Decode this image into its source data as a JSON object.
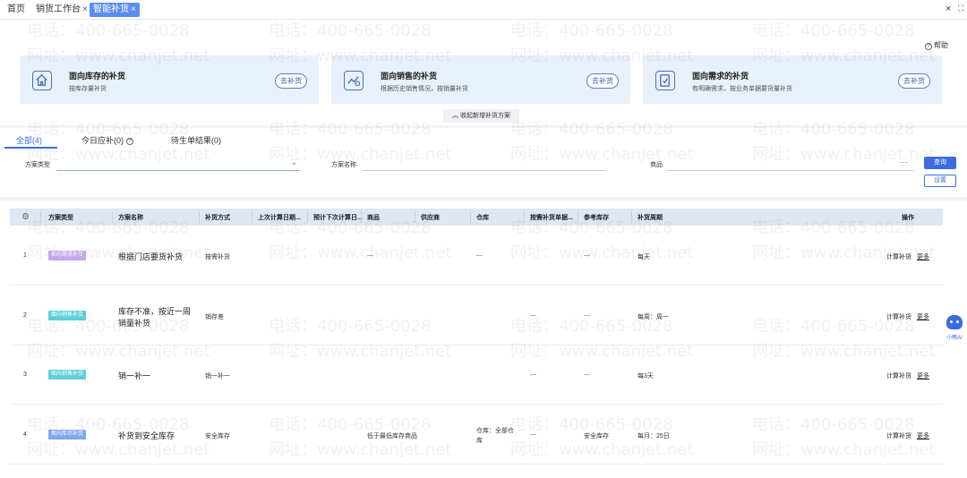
{
  "tabs": [
    {
      "label": "首页",
      "closable": false
    },
    {
      "label": "销货工作台",
      "closable": true
    },
    {
      "label": "智能补货",
      "closable": true,
      "active": true
    }
  ],
  "window": {
    "close": "×",
    "fullscreen": "⛶"
  },
  "help": {
    "label": "帮助"
  },
  "cards": [
    {
      "title": "面向库存的补货",
      "desc": "按库存量补货",
      "button": "去补货",
      "icon": "house-icon"
    },
    {
      "title": "面向销售的补货",
      "desc": "根据历史销售情况，按销量补货",
      "button": "去补货",
      "icon": "chart-icon"
    },
    {
      "title": "面向需求的补货",
      "desc": "有明确需求，按业务单据要货量补货",
      "button": "去补货",
      "icon": "clipboard-icon"
    }
  ],
  "collapse_label": "收起新增补货方案",
  "subtabs": [
    {
      "label": "全部(4)",
      "active": true
    },
    {
      "label": "今日应补(0)",
      "has_help": true
    },
    {
      "label": "待生单结果(0)"
    }
  ],
  "filters": {
    "type_label": "方案类型",
    "name_label": "方案名称",
    "product_label": "商品",
    "product_more": "···",
    "query_button": "查询",
    "settings_button": "设置"
  },
  "table": {
    "headers": [
      "方案类型",
      "方案名称",
      "补货方式",
      "上次计算日期...",
      "预计下次计算日...",
      "商品",
      "供应商",
      "仓库",
      "按需补货单据...",
      "参考库存",
      "补货周期",
      "操作"
    ],
    "rows": [
      {
        "index": "1",
        "type": "面向需求补货",
        "type_color": "purple",
        "name": [
          "根据门店要货补货"
        ],
        "method": "按需补货",
        "product": "—",
        "warehouse": "—",
        "demand_doc": "",
        "ref_stock": "—",
        "cycle": "每天",
        "op_calc": "计算补货",
        "op_more": "更多"
      },
      {
        "index": "2",
        "type": "面向销售补货",
        "type_color": "teal",
        "name": [
          "库存不准，按近一周",
          "销量补货"
        ],
        "method": "销存差",
        "product": "",
        "warehouse": "",
        "demand_doc": "—",
        "ref_stock": "—",
        "cycle": "每周：周一",
        "op_calc": "计算补货",
        "op_more": "更多"
      },
      {
        "index": "3",
        "type": "面向销售补货",
        "type_color": "teal",
        "name": [
          "销一补一"
        ],
        "method": "销一补一",
        "product": "",
        "warehouse": "",
        "demand_doc": "—",
        "ref_stock": "—",
        "cycle": "每3天",
        "op_calc": "计算补货",
        "op_more": "更多"
      },
      {
        "index": "4",
        "type": "面向库存补货",
        "type_color": "blue",
        "name": [
          "补货到安全库存"
        ],
        "method": "安全库存",
        "product": "低于最低库存商品",
        "warehouse": [
          "仓库：全部仓",
          "库"
        ],
        "demand_doc": "—",
        "ref_stock": "安全库存",
        "cycle": "每月：25日",
        "op_calc": "计算补货",
        "op_more": "更多"
      }
    ]
  },
  "watermark": {
    "phone": "电话：400-665-0028",
    "site": "网址：www.chanjet.net"
  },
  "assistant": {
    "label": "小畅AI"
  }
}
